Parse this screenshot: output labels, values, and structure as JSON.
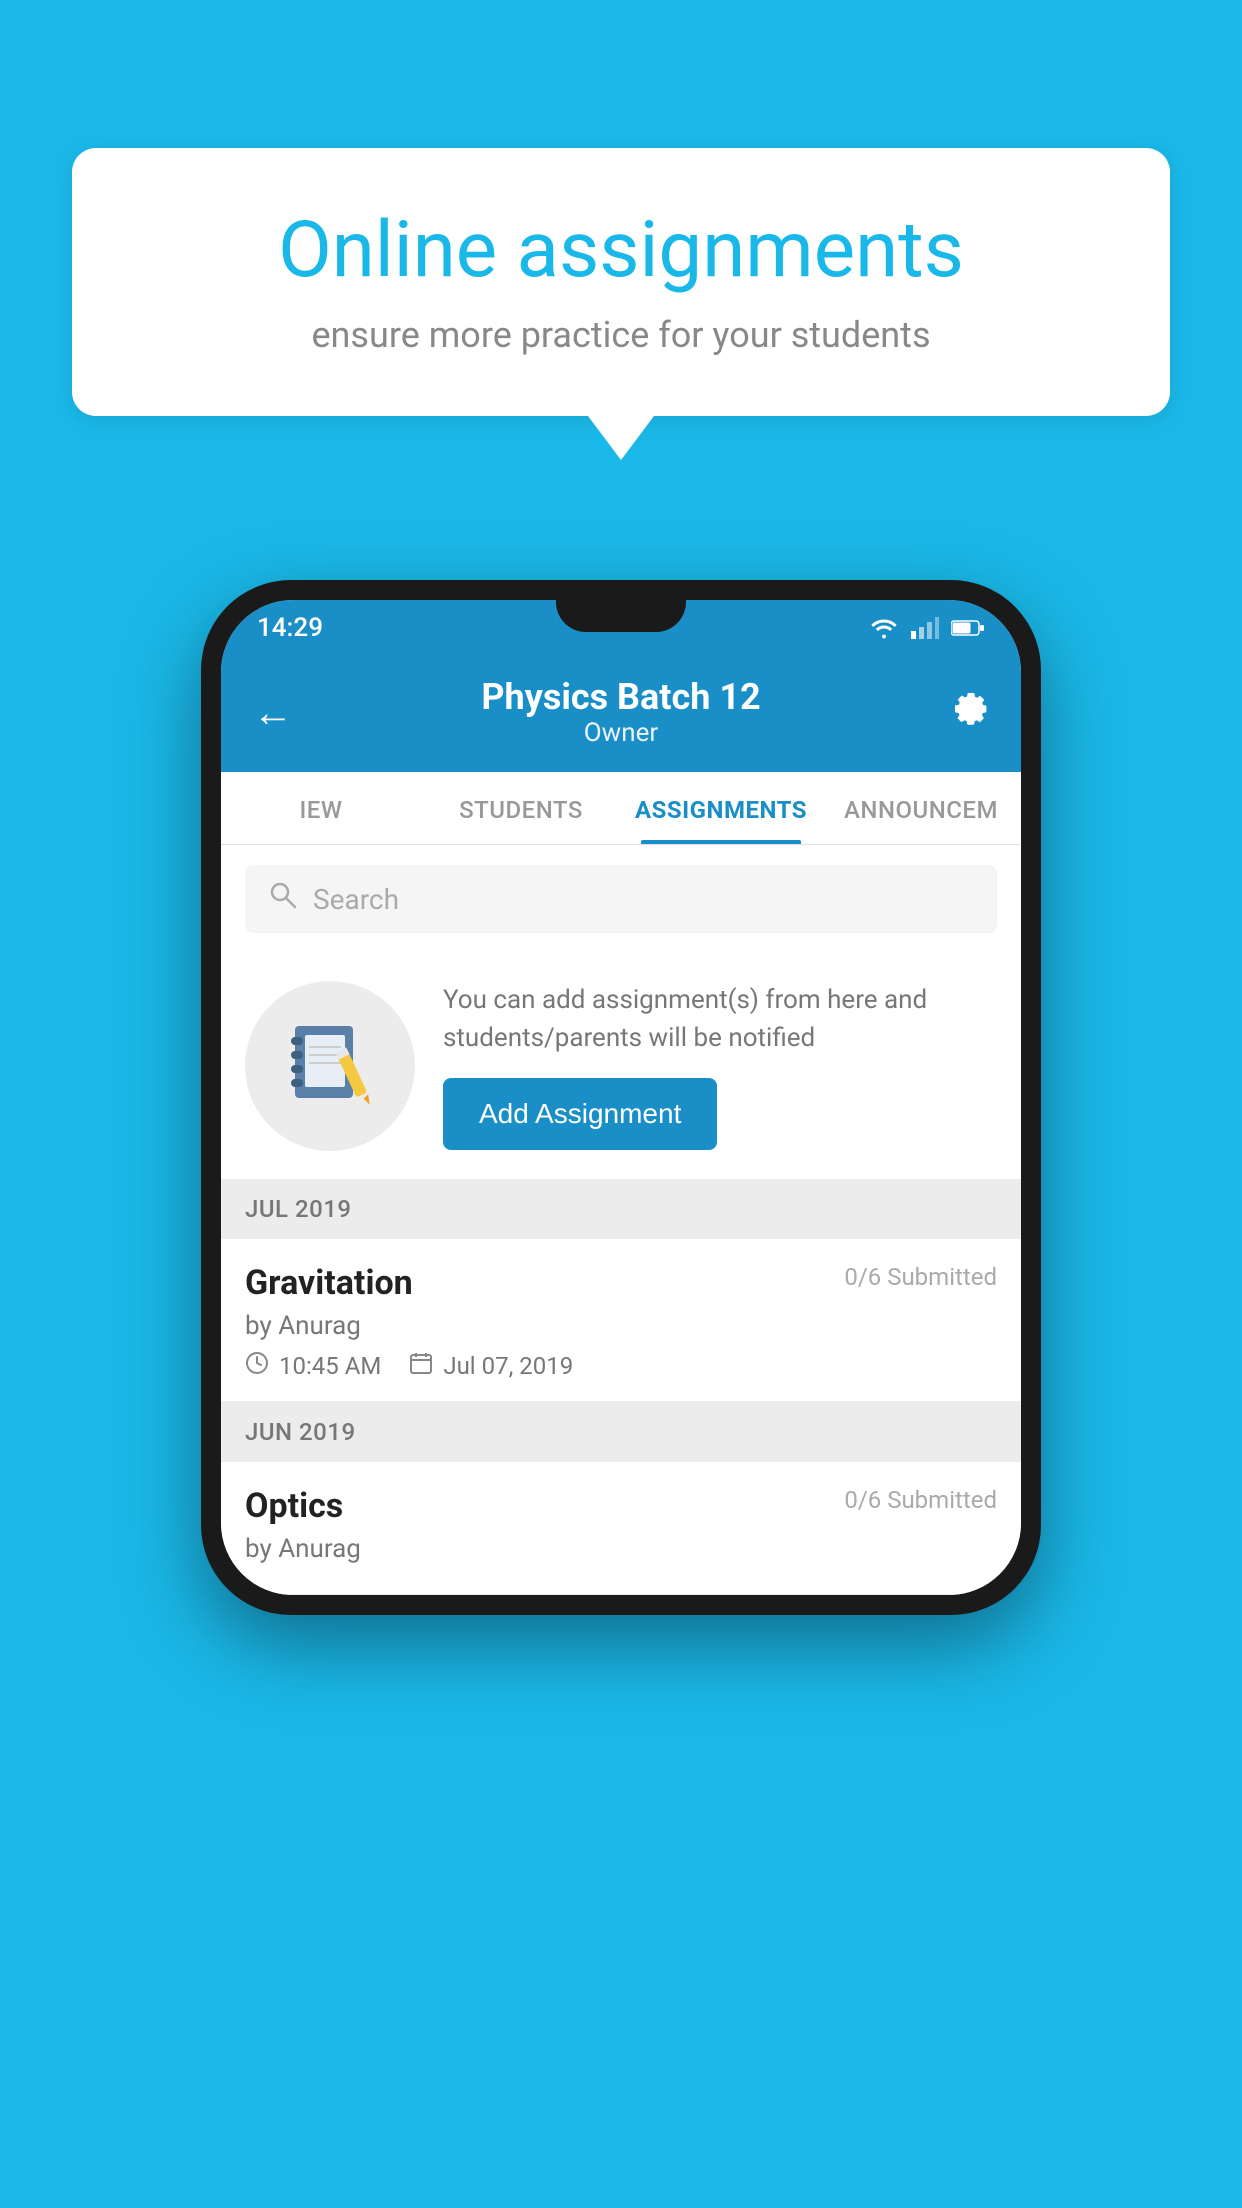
{
  "background_color": "#1ab8e8",
  "speech_bubble": {
    "title": "Online assignments",
    "subtitle": "ensure more practice for your students"
  },
  "status_bar": {
    "time": "14:29"
  },
  "app_header": {
    "title": "Physics Batch 12",
    "subtitle": "Owner",
    "back_label": "←",
    "gear_label": "⚙"
  },
  "tabs": [
    {
      "label": "IEW",
      "active": false
    },
    {
      "label": "STUDENTS",
      "active": false
    },
    {
      "label": "ASSIGNMENTS",
      "active": true
    },
    {
      "label": "ANNOUNCEM",
      "active": false
    }
  ],
  "search": {
    "placeholder": "Search"
  },
  "promo": {
    "text": "You can add assignment(s) from here and students/parents will be notified",
    "button_label": "Add Assignment"
  },
  "sections": [
    {
      "header": "JUL 2019",
      "assignments": [
        {
          "title": "Gravitation",
          "submitted": "0/6 Submitted",
          "by": "by Anurag",
          "time": "10:45 AM",
          "date": "Jul 07, 2019"
        }
      ]
    },
    {
      "header": "JUN 2019",
      "assignments": [
        {
          "title": "Optics",
          "submitted": "0/6 Submitted",
          "by": "by Anurag",
          "time": "",
          "date": ""
        }
      ]
    }
  ]
}
